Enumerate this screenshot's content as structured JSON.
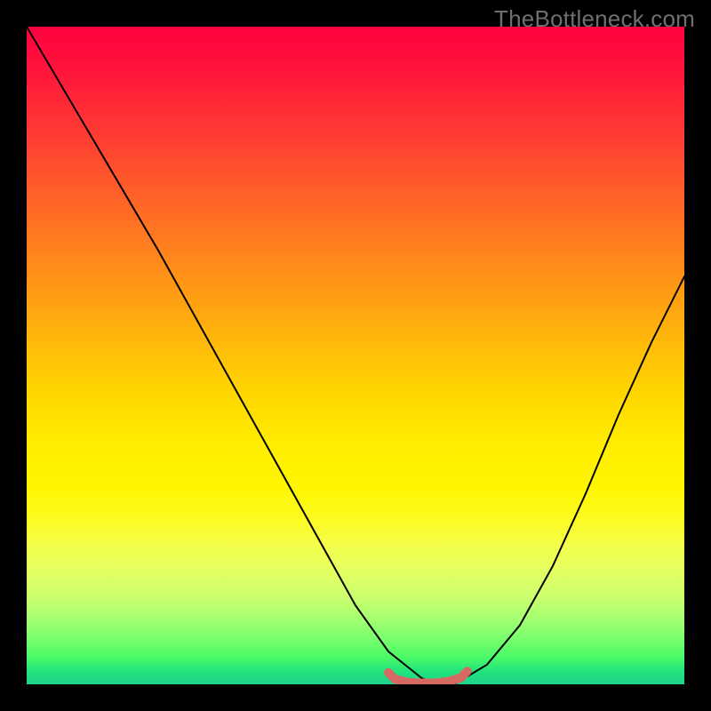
{
  "watermark": "TheBottleneck.com",
  "chart_data": {
    "type": "line",
    "title": "",
    "xlabel": "",
    "ylabel": "",
    "xlim": [
      0,
      100
    ],
    "ylim": [
      0,
      100
    ],
    "grid": false,
    "legend": false,
    "background": "rainbow-vertical-gradient",
    "gradient_stops": [
      {
        "pct": 0,
        "color": "#ff0040"
      },
      {
        "pct": 25,
        "color": "#ff6a24"
      },
      {
        "pct": 50,
        "color": "#ffc400"
      },
      {
        "pct": 70,
        "color": "#fff600"
      },
      {
        "pct": 85,
        "color": "#c8ff6e"
      },
      {
        "pct": 100,
        "color": "#1fd18b"
      }
    ],
    "series": [
      {
        "name": "bottleneck-curve",
        "color": "#000000",
        "stroke_width": 2,
        "x": [
          0.0,
          10,
          20,
          30,
          40,
          45,
          50,
          55,
          60,
          62,
          65,
          70,
          75,
          80,
          85,
          90,
          95,
          100
        ],
        "y": [
          100,
          83,
          66,
          48,
          30,
          21,
          12,
          5,
          1,
          0,
          0,
          3,
          9,
          18,
          29,
          41,
          52,
          62
        ]
      }
    ],
    "annotations": [
      {
        "name": "valley-marker",
        "kind": "rounded-segment",
        "color": "#d66a63",
        "stroke_width": 10,
        "x": [
          55,
          56,
          58,
          60,
          62,
          64,
          66,
          67
        ],
        "y": [
          1.8,
          0.8,
          0.3,
          0.2,
          0.2,
          0.4,
          1.0,
          2.0
        ]
      }
    ]
  }
}
